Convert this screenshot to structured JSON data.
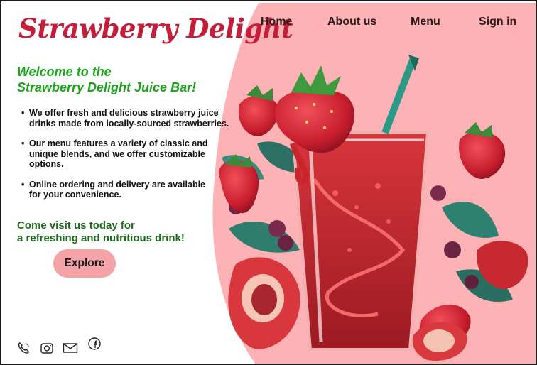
{
  "brand": {
    "name": "Strawberry Delight",
    "accent": "#c41e3a",
    "blob_color": "#fdb2b5"
  },
  "nav": {
    "home": "Home",
    "about": "About us",
    "menu": "Menu",
    "signin": "Sign in"
  },
  "hero": {
    "welcome_line1": "Welcome to the",
    "welcome_line2": "Strawberry Delight Juice Bar!",
    "features": [
      {
        "line1": "We offer fresh and delicious strawberry juice",
        "line2": "drinks made from locally-sourced strawberries.",
        "line3": ""
      },
      {
        "line1": "Our menu features a variety of classic and",
        "line2": "unique blends, and we offer customizable",
        "line3": "options."
      },
      {
        "line1": "Online ordering and delivery are available",
        "line2": "for your convenience.",
        "line3": ""
      }
    ],
    "cta_line1": "Come visit us today for",
    "cta_line2": "a refreshing and nutritious drink!",
    "explore_label": "Explore"
  },
  "social": {
    "icons": [
      "phone-icon",
      "instagram-icon",
      "mail-icon",
      "facebook-icon"
    ]
  },
  "illustration": {
    "subject": "strawberry-juice-glass-illustration"
  }
}
